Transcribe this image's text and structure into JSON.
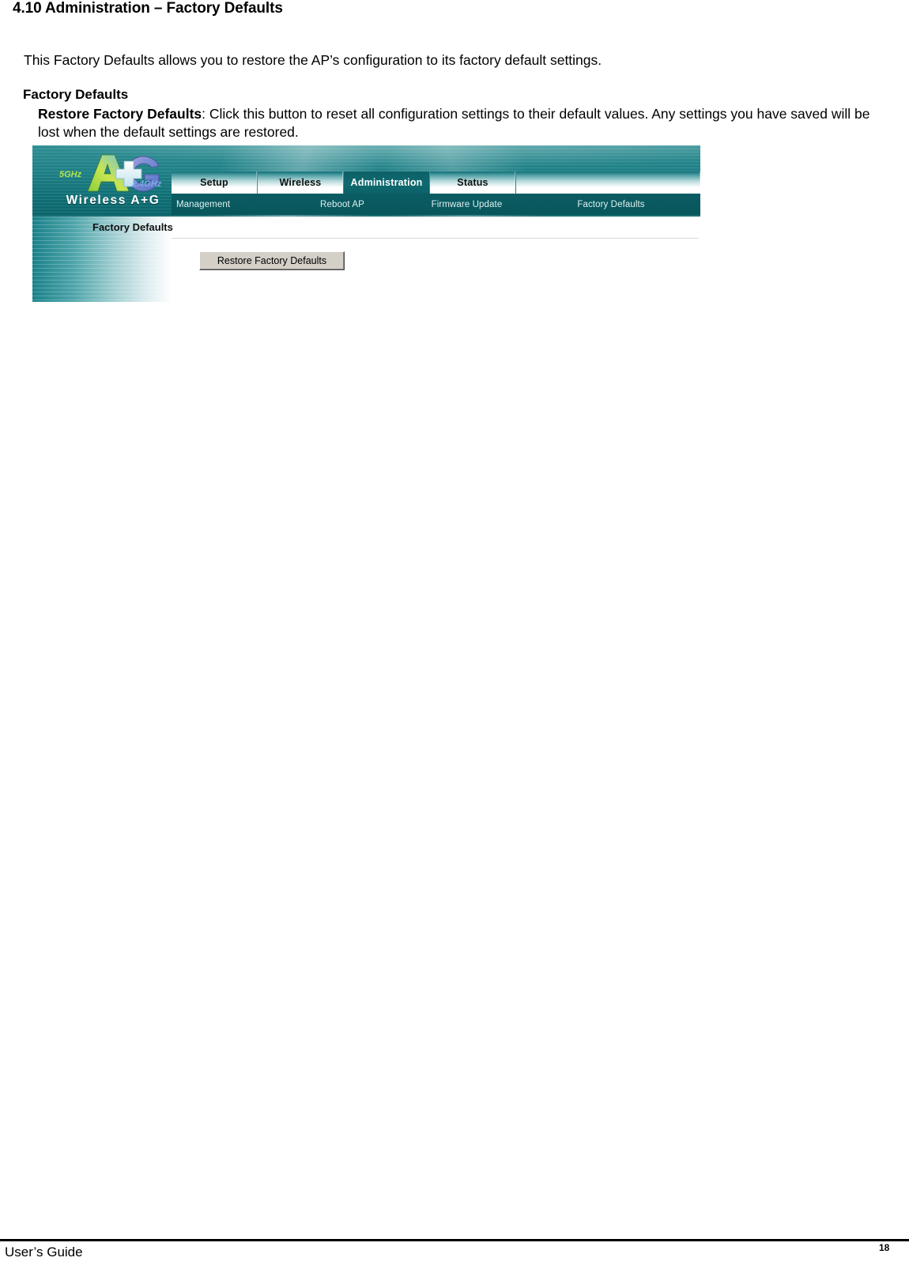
{
  "document": {
    "heading": "4.10 Administration – Factory Defaults",
    "intro_paragraph": "This Factory Defaults allows you to restore the AP’s configuration to its factory default settings.",
    "section_label": "Factory Defaults",
    "bullet": {
      "term": "Restore Factory Defaults",
      "description": ": Click this button to reset all configuration settings to their default values. Any settings you have saved will be lost when the default settings are restored."
    }
  },
  "screenshot": {
    "logo": {
      "brand_text": "Wireless A+G",
      "band_5ghz_label": "5GHz",
      "band_24ghz_label": "2.4GHz",
      "letter_a": "A",
      "letter_g": "G",
      "plus": "+"
    },
    "tabs": [
      {
        "label": "Setup",
        "active": false
      },
      {
        "label": "Wireless",
        "active": false
      },
      {
        "label": "Administration",
        "active": true
      },
      {
        "label": "Status",
        "active": false
      }
    ],
    "subnav": [
      {
        "label": "Management"
      },
      {
        "label": "Reboot AP"
      },
      {
        "label": "Firmware Update"
      },
      {
        "label": "Factory Defaults"
      }
    ],
    "panel_title": "Factory Defaults",
    "restore_button_label": "Restore Factory Defaults"
  },
  "footer": {
    "left_text": "User’s Guide",
    "page_number": "18"
  },
  "colors": {
    "header_teal_top": "#2f8e93",
    "header_teal_bottom": "#0a646a",
    "subnav_bg": "#0a5d63",
    "active_tab_bg": "#0c6066",
    "sidebar_teal": "#1b8189",
    "button_face": "#d4d0c8"
  }
}
